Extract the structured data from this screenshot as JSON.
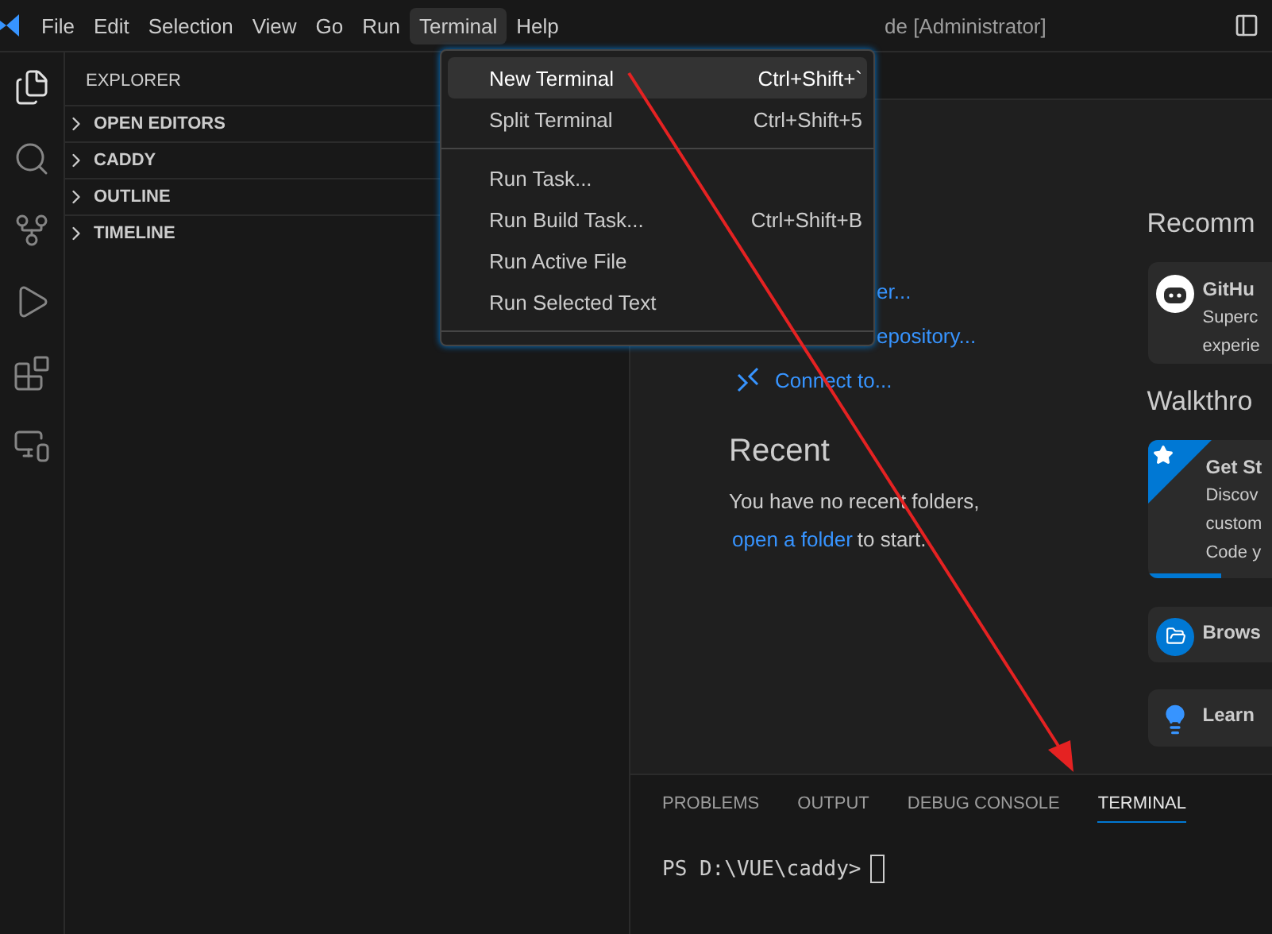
{
  "title_bar": {
    "menus": [
      {
        "label": "File",
        "selected": false
      },
      {
        "label": "Edit",
        "selected": false
      },
      {
        "label": "Selection",
        "selected": false
      },
      {
        "label": "View",
        "selected": false
      },
      {
        "label": "Go",
        "selected": false
      },
      {
        "label": "Run",
        "selected": false
      },
      {
        "label": "Terminal",
        "selected": true
      },
      {
        "label": "Help",
        "selected": false
      }
    ],
    "title": "de [Administrator]"
  },
  "activity_bar": {
    "items": [
      {
        "kind": "files",
        "selected": true
      },
      {
        "kind": "search",
        "selected": false
      },
      {
        "kind": "source-control",
        "selected": false
      },
      {
        "kind": "run-debug",
        "selected": false
      },
      {
        "kind": "extensions",
        "selected": false
      },
      {
        "kind": "remote",
        "selected": false
      }
    ]
  },
  "sidebar": {
    "title": "EXPLORER",
    "sections": [
      {
        "label": "OPEN EDITORS",
        "expanded": false
      },
      {
        "label": "CADDY",
        "expanded": false
      },
      {
        "label": "OUTLINE",
        "expanded": false
      },
      {
        "label": "TIMELINE",
        "expanded": false
      }
    ]
  },
  "terminal_menu": {
    "items": [
      {
        "kind": "item",
        "label": "New Terminal",
        "shortcut": "Ctrl+Shift+`",
        "selected": true
      },
      {
        "kind": "item",
        "label": "Split Terminal",
        "shortcut": "Ctrl+Shift+5",
        "selected": false
      },
      {
        "kind": "separator"
      },
      {
        "kind": "item",
        "label": "Run Task...",
        "selected": false
      },
      {
        "kind": "item",
        "label": "Run Build Task...",
        "shortcut": "Ctrl+Shift+B",
        "selected": false
      },
      {
        "kind": "item",
        "label": "Run Active File",
        "selected": false
      },
      {
        "kind": "item",
        "label": "Run Selected Text",
        "selected": false
      },
      {
        "kind": "separator"
      }
    ]
  },
  "welcome": {
    "start": [
      {
        "kind": "covered",
        "label": "er..."
      },
      {
        "kind": "covered",
        "label": "epository..."
      },
      {
        "kind": "remote",
        "label": "Connect to..."
      }
    ],
    "recent": {
      "title": "Recent",
      "text": "You have no recent folders,",
      "link": "open a folder",
      "after": "to start."
    },
    "recommended": {
      "title": "Recomm",
      "cards": [
        {
          "kind": "github",
          "title": "GitHu",
          "lines": [
            "Superc",
            "experie"
          ]
        }
      ]
    },
    "walkthroughs": {
      "title": "Walkthro",
      "cards": [
        {
          "kind": "featured",
          "title": "Get St",
          "lines": [
            "Discov",
            "custom",
            "Code y"
          ],
          "level": 0.59
        },
        {
          "kind": "browse",
          "title": "Brows"
        },
        {
          "kind": "learn",
          "title": "Learn"
        }
      ]
    }
  },
  "panel": {
    "tabs": [
      {
        "label": "PROBLEMS",
        "selected": false
      },
      {
        "label": "OUTPUT",
        "selected": false
      },
      {
        "label": "DEBUG CONSOLE",
        "selected": false
      },
      {
        "label": "TERMINAL",
        "selected": true
      }
    ],
    "prompt": "PS D:\\VUE\\caddy>"
  }
}
